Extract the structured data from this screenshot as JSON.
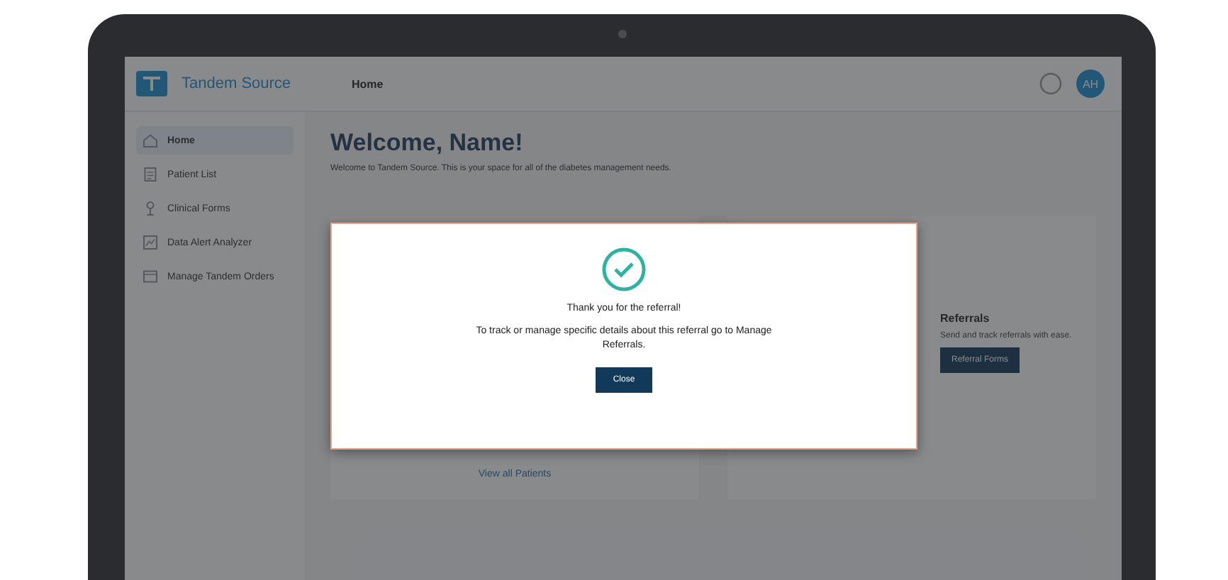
{
  "header": {
    "brand": "Tandem Source",
    "page_title": "Home",
    "avatar": "AH"
  },
  "sidebar": {
    "items": [
      {
        "label": "Home",
        "selected": true
      },
      {
        "label": "Patient List",
        "selected": false
      },
      {
        "label": "Clinical Forms",
        "selected": false
      },
      {
        "label": "Data Alert Analyzer",
        "selected": false
      },
      {
        "label": "Manage Tandem Orders",
        "selected": false
      }
    ]
  },
  "main": {
    "heading": "Welcome, Name!",
    "intro": "Welcome to Tandem Source. This is your space for all of the diabetes management needs.",
    "link": "View all Patients",
    "card": {
      "title": "Referrals",
      "text": "Send and track referrals with ease.",
      "button": "Referral Forms"
    }
  },
  "dialog": {
    "message": "Thank you for the referral!",
    "detail": "To track or manage specific details about this referral go to Manage Referrals.",
    "button": "Close"
  }
}
